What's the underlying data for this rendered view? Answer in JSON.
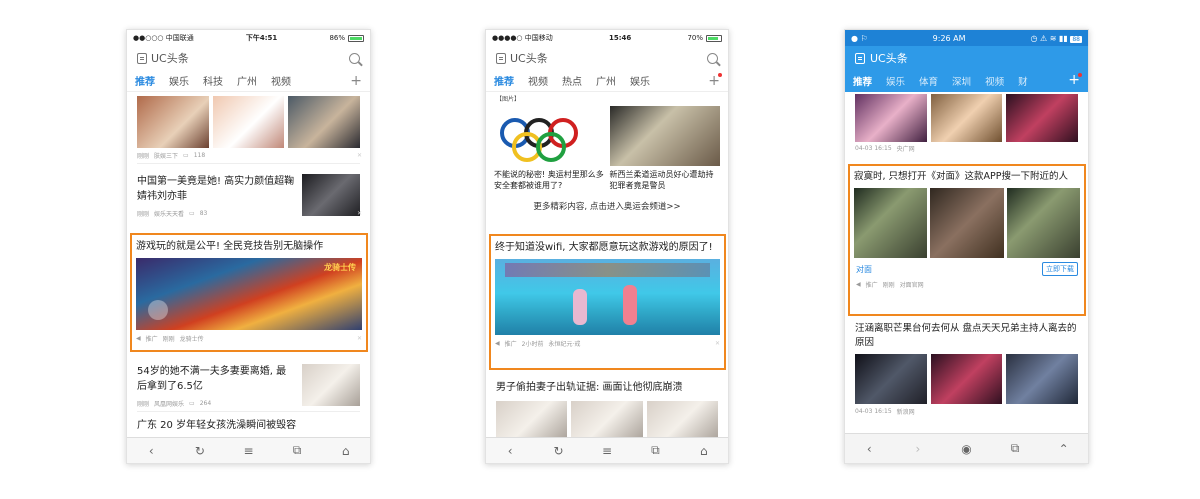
{
  "phone1": {
    "status": {
      "carrier": "●●○○○ 中国联通",
      "time": "下午4:51",
      "battery": "86%"
    },
    "app_title": "UC头条",
    "tabs": [
      "推荐",
      "娱乐",
      "科技",
      "广州",
      "视频"
    ],
    "articles": [
      {
        "meta_time": "刚刚",
        "meta_source": "肤娱三下",
        "meta_count": "118"
      },
      {
        "title": "中国第一美竟是她! 高实力颜值超鞠婧祎刘亦菲",
        "meta_time": "刚刚",
        "meta_source": "娱乐天天看",
        "meta_count": "83"
      },
      {
        "title": "游戏玩的就是公平! 全民竞技告别无脑操作",
        "meta_tag": "推广",
        "meta_time": "刚刚",
        "meta_source": "龙骑士传",
        "ad": true,
        "game_logo": "龙骑士传"
      },
      {
        "title": "54岁的她不满一夫多妻要离婚, 最后拿到了6.5亿",
        "meta_time": "刚刚",
        "meta_source": "风凰网娱乐",
        "meta_count": "264"
      },
      {
        "title": "广东 20 岁年轻女孩洗澡瞬间被毁容"
      }
    ]
  },
  "phone2": {
    "status": {
      "carrier": "●●●●○ 中国移动",
      "time": "15:46",
      "battery": "70%"
    },
    "app_title": "UC头条",
    "tabs": [
      "推荐",
      "视频",
      "热点",
      "广州",
      "娱乐"
    ],
    "top_label": "【图片】",
    "olympics": [
      {
        "caption": "不能说的秘密! 奥运村里那么多安全套都被谁用了?"
      },
      {
        "caption": "新西兰柔道运动员好心遭劫持 犯罪者竟是警员"
      }
    ],
    "more_link": "更多精彩内容, 点击进入奥运会频道>>",
    "ad": {
      "title": "终于知道没wifi, 大家都愿意玩这款游戏的原因了!",
      "meta_tag": "推广",
      "meta_time": "2小时前",
      "meta_source": "永恒纪元·戒"
    },
    "next_title": "男子偷拍妻子出轨证据: 画面让他彻底崩溃"
  },
  "phone3": {
    "status": {
      "time": "9:26 AM",
      "battery": "88"
    },
    "app_title": "UC头条",
    "tabs": [
      "推荐",
      "娱乐",
      "体育",
      "深圳",
      "视频",
      "财"
    ],
    "first_meta": {
      "time": "04-03 16:15",
      "source": "央广网"
    },
    "ad": {
      "title": "寂寞时, 只想打开《对面》这款APP搜一下附近的人",
      "brand": "对面",
      "cta": "立即下载",
      "meta_tag": "推广",
      "meta_time": "刚刚",
      "meta_source": "对面官网"
    },
    "article": {
      "title": "汪涵离职芒果台何去何从 盘点天天兄弟主持人离去的原因",
      "meta_time": "04-03 16:15",
      "meta_source": "新浪网"
    }
  },
  "colors": {
    "accent_blue": "#2a8ae0",
    "highlight_orange": "#f0871e",
    "android_blue": "#2e9ae8"
  }
}
